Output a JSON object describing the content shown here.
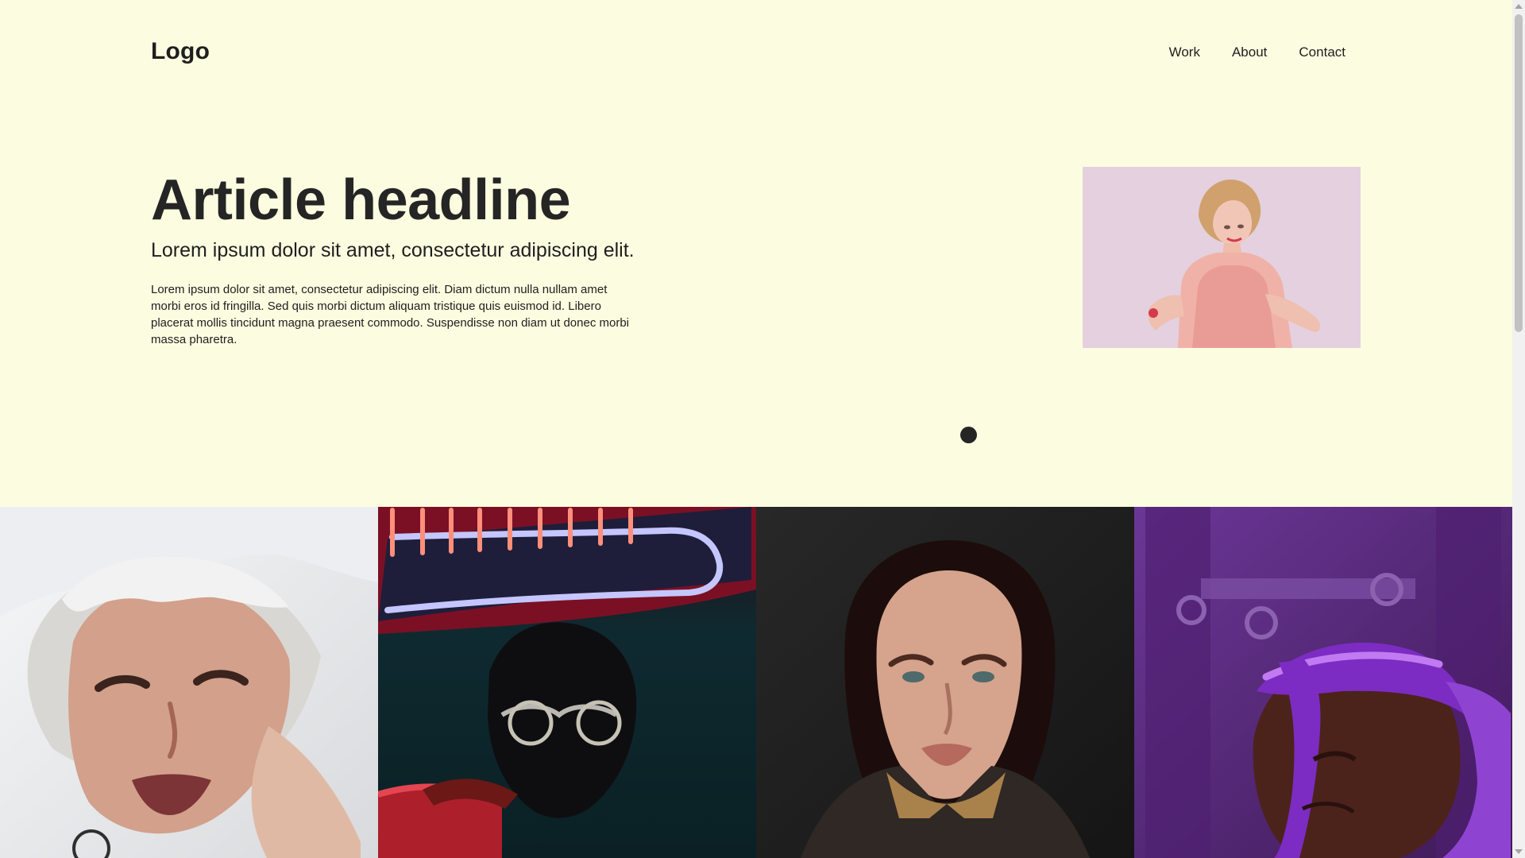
{
  "brand": {
    "logo_text": "Logo"
  },
  "nav": {
    "items": [
      {
        "label": "Work"
      },
      {
        "label": "About"
      },
      {
        "label": "Contact"
      }
    ]
  },
  "hero": {
    "headline": "Article headline",
    "subheadline": "Lorem ipsum dolor sit amet, consectetur adipiscing elit.",
    "body": "Lorem ipsum dolor sit amet, consectetur adipiscing elit. Diam dictum nulla nullam amet morbi eros id fringilla. Sed quis morbi dictum aliquam tristique quis euismod id. Libero placerat mollis tincidunt magna praesent commodo. Suspendisse non diam ut donec morbi massa pharetra."
  },
  "carousel": {
    "active_dot": 1,
    "dot_count": 1
  },
  "gallery": {
    "images": [
      {
        "icon": "portrait-image"
      },
      {
        "icon": "portrait-image"
      },
      {
        "icon": "portrait-image"
      },
      {
        "icon": "portrait-image"
      }
    ]
  },
  "colors": {
    "background": "#fcfde0",
    "text": "#1f1f1f",
    "accent_dark": "#252525",
    "hero_image_bg": "#e4d0df",
    "tile_1_bg": "#e9eaee",
    "tile_2_bg": "#0f2b31",
    "tile_3_bg": "#1b1b1b",
    "tile_4_bg": "#5c2b85"
  }
}
